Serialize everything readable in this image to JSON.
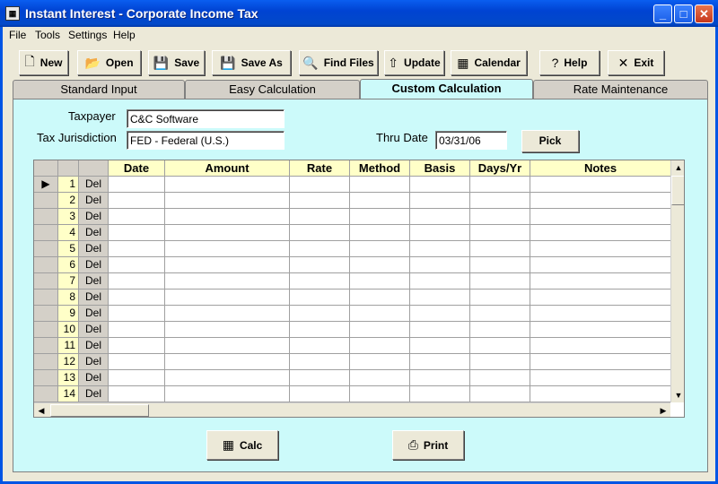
{
  "window": {
    "title": "Instant Interest - Corporate Income Tax",
    "app_icon": "calculator-icon"
  },
  "menu": [
    {
      "label": "File"
    },
    {
      "label": "Tools"
    },
    {
      "label": "Settings"
    },
    {
      "label": "Help"
    }
  ],
  "toolbar": {
    "new": "New",
    "open": "Open",
    "save": "Save",
    "save_as": "Save As",
    "find_files": "Find Files",
    "update": "Update",
    "calendar": "Calendar",
    "help": "Help",
    "exit": "Exit"
  },
  "tabs": {
    "standard": "Standard Input",
    "easy": "Easy Calculation",
    "custom": "Custom Calculation",
    "rate": "Rate Maintenance",
    "active": "custom"
  },
  "form": {
    "taxpayer_label": "Taxpayer",
    "taxpayer_value": "C&C Software",
    "jurisdiction_label": "Tax Jurisdiction",
    "jurisdiction_value": "FED - Federal (U.S.)",
    "thru_date_label": "Thru Date",
    "thru_date_value": "03/31/06",
    "pick": "Pick"
  },
  "grid": {
    "columns": [
      "Date",
      "Amount",
      "Rate",
      "Method",
      "Basis",
      "Days/Yr",
      "Notes"
    ],
    "rows": [
      {
        "num": "1",
        "del": "Del"
      },
      {
        "num": "2",
        "del": "Del"
      },
      {
        "num": "3",
        "del": "Del"
      },
      {
        "num": "4",
        "del": "Del"
      },
      {
        "num": "5",
        "del": "Del"
      },
      {
        "num": "6",
        "del": "Del"
      },
      {
        "num": "7",
        "del": "Del"
      },
      {
        "num": "8",
        "del": "Del"
      },
      {
        "num": "9",
        "del": "Del"
      },
      {
        "num": "10",
        "del": "Del"
      },
      {
        "num": "11",
        "del": "Del"
      },
      {
        "num": "12",
        "del": "Del"
      },
      {
        "num": "13",
        "del": "Del"
      },
      {
        "num": "14",
        "del": "Del"
      }
    ],
    "current_row_marker": "▶"
  },
  "actions": {
    "calc": "Calc",
    "print": "Print"
  },
  "colors": {
    "panel_bg": "#ccfafa",
    "header_bg": "#ffffc8",
    "title_blue": "#0043d2"
  }
}
